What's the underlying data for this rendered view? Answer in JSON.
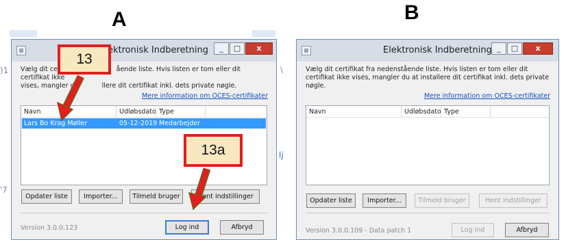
{
  "labels": {
    "a": "A",
    "b": "B"
  },
  "edge_fragments": {
    "left_1": ")1",
    "left_7": "'7",
    "right_slash": "\\",
    "right_lj": "lj",
    "right_c": "("
  },
  "panel_a": {
    "title": "ektronisk Indberetning",
    "window_buttons": {
      "minimize": "_",
      "maximize": "□",
      "close": "x"
    },
    "intro_start": "Vælg dit cert",
    "intro_mid": "ående liste. Hvis listen er tom eller dit certifikat ikke",
    "intro_line2_start": "vises, mangler d",
    "intro_line2_end": "llere dit certifikat inkl. dets private nøgle.",
    "info_link": "Mere information om OCES-certifikater",
    "columns": {
      "name": "Navn",
      "expiry": "Udløbsdato",
      "type": "Type"
    },
    "rows": [
      {
        "name": "Lars Bo Krag Møller",
        "expiry": "05-12-2019",
        "type": "Medarbejder"
      }
    ],
    "buttons": {
      "refresh": "Opdater liste",
      "import": "Importer...",
      "enroll": "Tilmeld bruger",
      "settings": "Hent indstillinger",
      "login": "Log ind",
      "cancel": "Afbryd"
    },
    "version": "Version 3.0.0.123"
  },
  "panel_b": {
    "title": "Elektronisk Indberetning",
    "window_buttons": {
      "minimize": "_",
      "maximize": "□",
      "close": "x"
    },
    "intro": "Vælg dit certifikat fra nedenstående liste. Hvis listen er tom eller dit certifikat ikke vises, mangler du at installere dit certifikat inkl. dets private nøgle.",
    "info_link": "Mere information om OCES-certifikater",
    "columns": {
      "name": "Navn",
      "expiry": "Udløbsdato",
      "type": "Type"
    },
    "buttons": {
      "refresh": "Opdater liste",
      "import": "Importer...",
      "enroll": "Tilmeld bruger",
      "settings": "Hent indstillinger",
      "login": "Log ind",
      "cancel": "Afbryd"
    },
    "version": "Version 3.0.0.109 - Data patch 1"
  },
  "callouts": {
    "step13": "13",
    "step13a": "13a"
  },
  "colors": {
    "callout_border": "#e41d1d",
    "callout_fill": "#f7e8c0",
    "selection": "#3399ff",
    "link": "#0d4ec3",
    "close_button": "#c73e2e"
  }
}
